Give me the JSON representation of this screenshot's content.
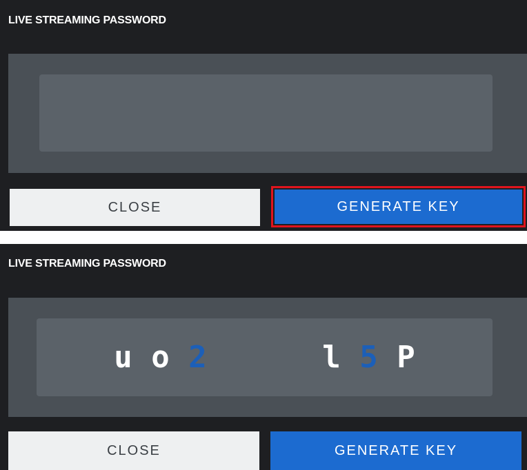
{
  "dialogs": [
    {
      "title": "LIVE STREAMING PASSWORD",
      "key_chars": [],
      "buttons": {
        "close_label": "CLOSE",
        "generate_label": "GENERATE KEY"
      },
      "generate_highlighted": true
    },
    {
      "title": "LIVE STREAMING PASSWORD",
      "key_chars": [
        {
          "char": "u",
          "color": "#ffffff"
        },
        {
          "char": "o",
          "color": "#ffffff"
        },
        {
          "char": "2",
          "color": "#1c5fb8"
        },
        {
          "char": "l",
          "color": "#ffffff"
        },
        {
          "char": "5",
          "color": "#1c5fb8"
        },
        {
          "char": "P",
          "color": "#ffffff"
        }
      ],
      "buttons": {
        "close_label": "CLOSE",
        "generate_label": "GENERATE KEY"
      },
      "generate_highlighted": false
    }
  ],
  "colors": {
    "background": "#1e1f22",
    "key_area": "#4a5056",
    "key_box": "#5b6269",
    "close_button": "#eef0f1",
    "generate_button": "#1c6bd0",
    "highlight_border": "#e0141e"
  }
}
